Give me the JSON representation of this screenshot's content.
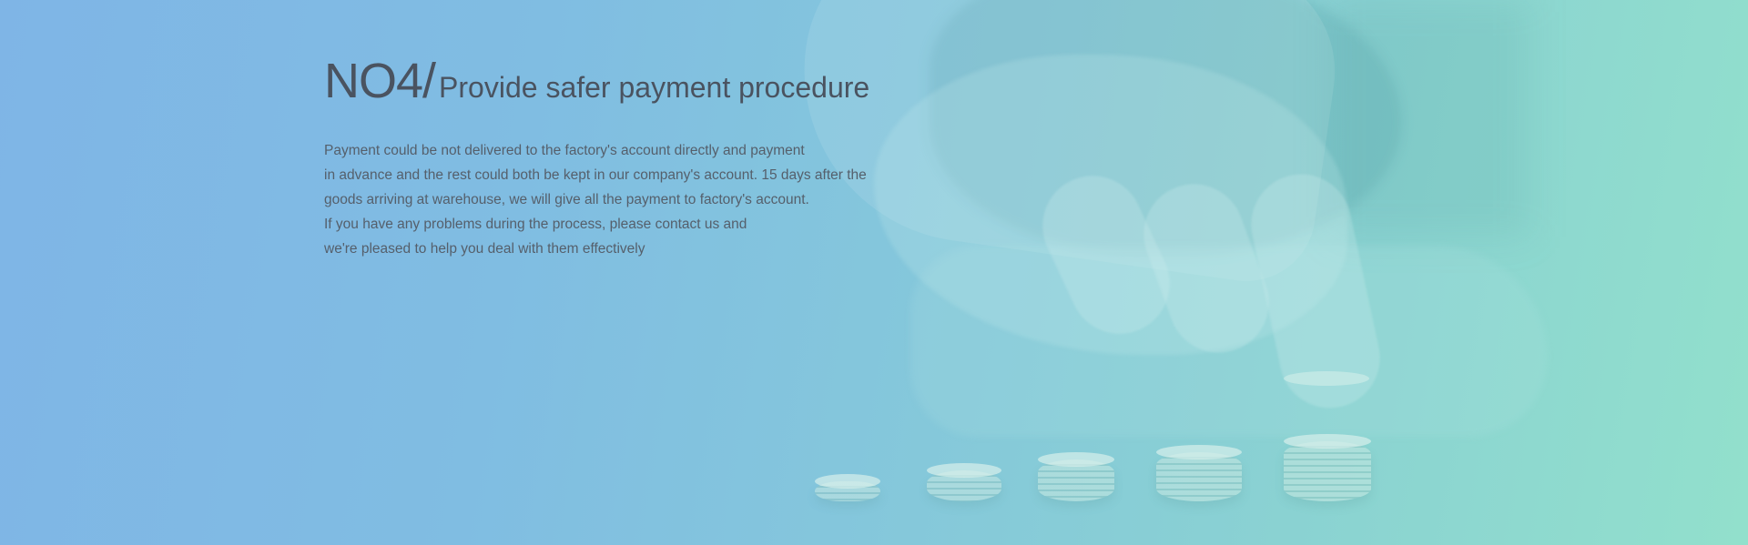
{
  "section": {
    "number": "NO4/",
    "title": "Provide safer payment procedure",
    "description_lines": [
      "Payment could be not delivered to the factory's account directly and payment",
      "in advance and the rest could both be kept in our company's account. 15 days after the",
      "goods arriving at warehouse, we will give all the payment to factory's account.",
      "If you have any problems during the process, please contact us and",
      "we're pleased to help you deal with them effectively"
    ]
  },
  "background": {
    "image": "hand-stacking-coins-photo",
    "gradient_start": "#7fb5e6",
    "gradient_end": "#92e0cc"
  },
  "colors": {
    "heading_text": "#4a5360",
    "body_text": "#555f6b"
  }
}
